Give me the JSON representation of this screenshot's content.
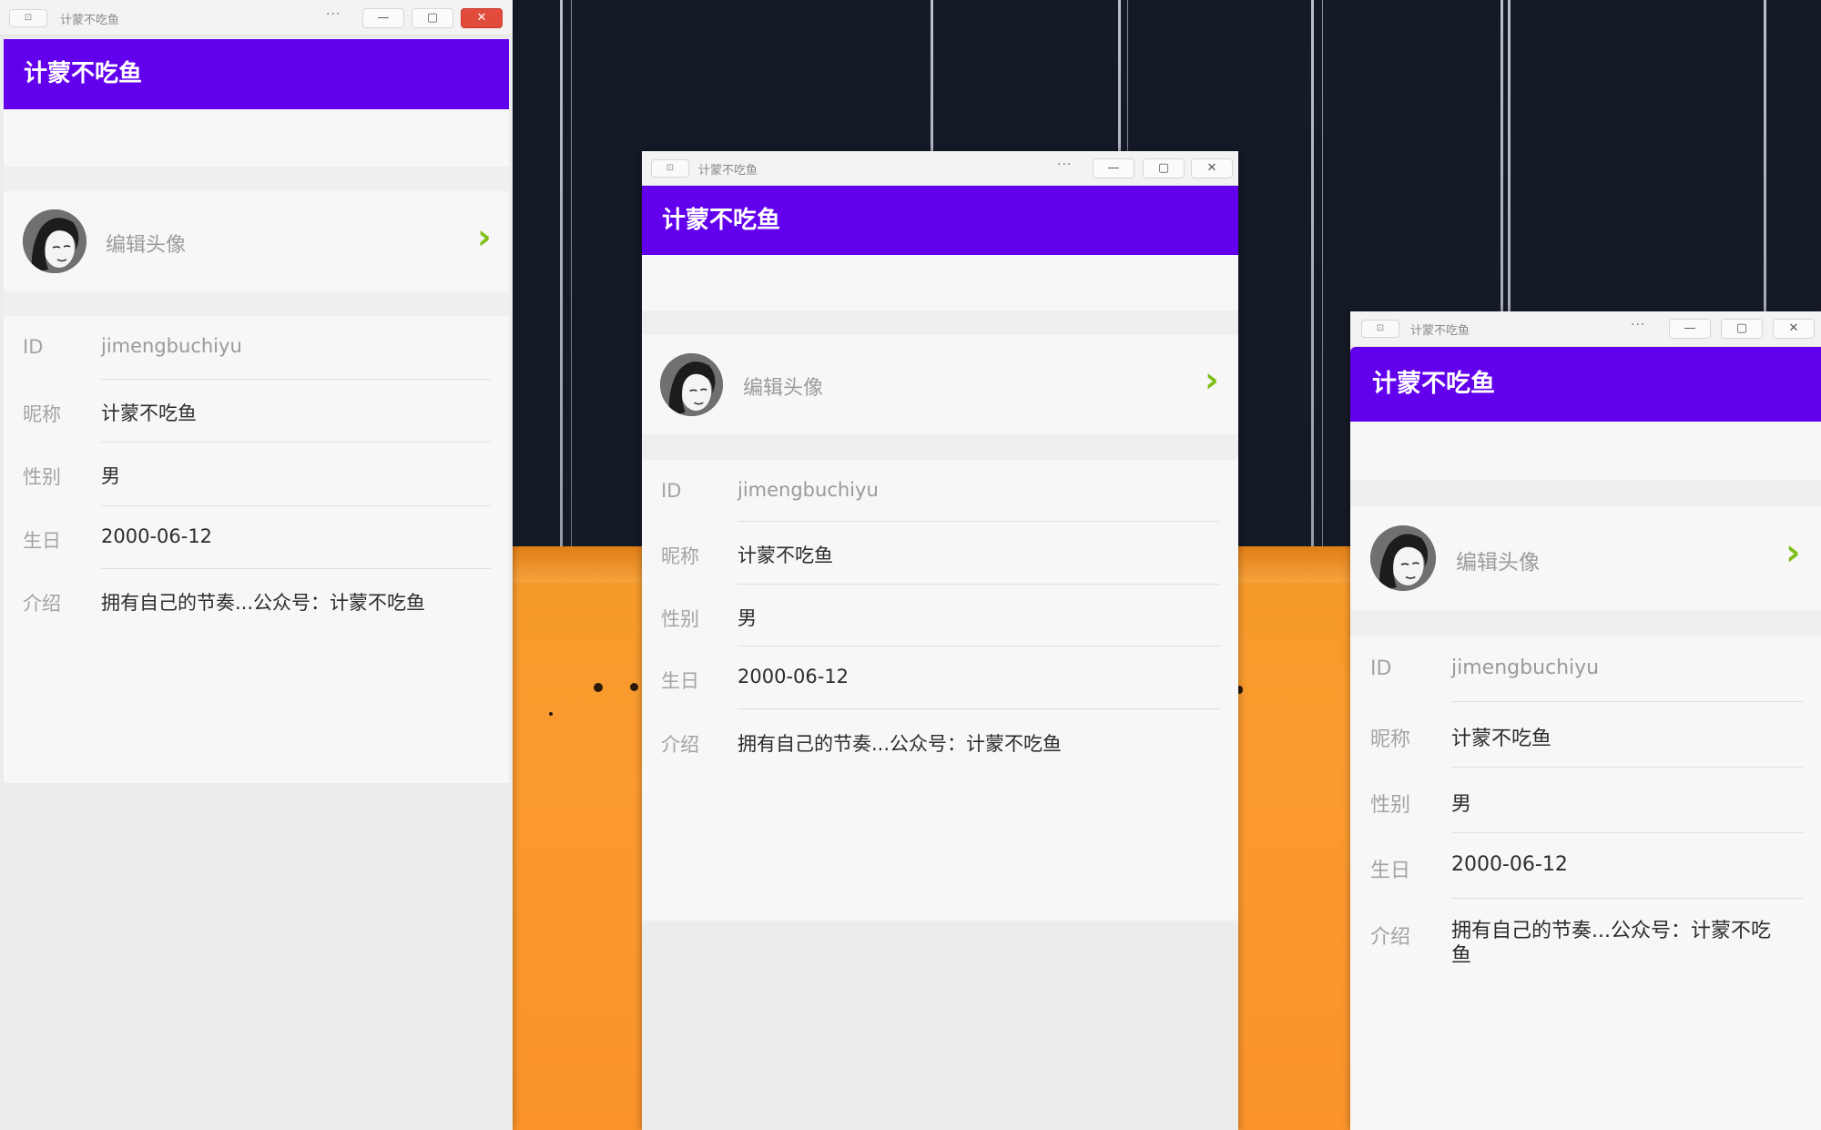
{
  "app": {
    "window_title": "计蒙不吃鱼",
    "appbar_title": "计蒙不吃鱼",
    "pin_icon": "pin-window-icon",
    "more_glyph": "···",
    "minimize_glyph": "—",
    "maximize_glyph": "▢",
    "close_glyph": "✕",
    "brand_color": "#6200ee",
    "chevron_color": "#7fbf1a"
  },
  "profile": {
    "edit_avatar_label": "编辑头像",
    "chevron_glyph": "›",
    "fields": [
      {
        "label": "ID",
        "value": "jimengbuchiyu"
      },
      {
        "label": "昵称",
        "value": "计蒙不吃鱼"
      },
      {
        "label": "性别",
        "value": "男"
      },
      {
        "label": "生日",
        "value": "2000-06-12"
      },
      {
        "label": "介绍",
        "value": "拥有自己的节奏...公众号：计蒙不吃鱼"
      }
    ]
  }
}
